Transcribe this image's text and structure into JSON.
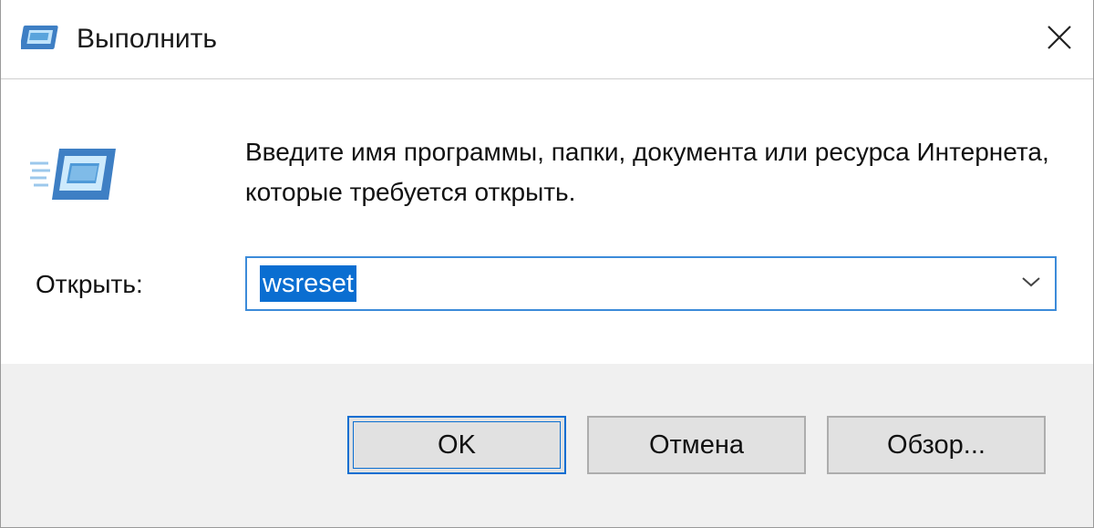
{
  "window": {
    "title": "Выполнить",
    "title_icon": "run-icon",
    "close_icon": "close-icon"
  },
  "content": {
    "app_icon": "run-icon",
    "description": "Введите имя программы, папки, документа или ресурса Интернета, которые требуется открыть.",
    "open_label": "Открыть:",
    "combo": {
      "value": "wsreset",
      "dropdown_icon": "chevron-down-icon"
    }
  },
  "buttons": {
    "ok": "OK",
    "cancel": "Отмена",
    "browse": "Обзор..."
  },
  "colors": {
    "accent": "#0a6ed1",
    "footer_bg": "#f0f0f0",
    "button_bg": "#e1e1e1"
  }
}
